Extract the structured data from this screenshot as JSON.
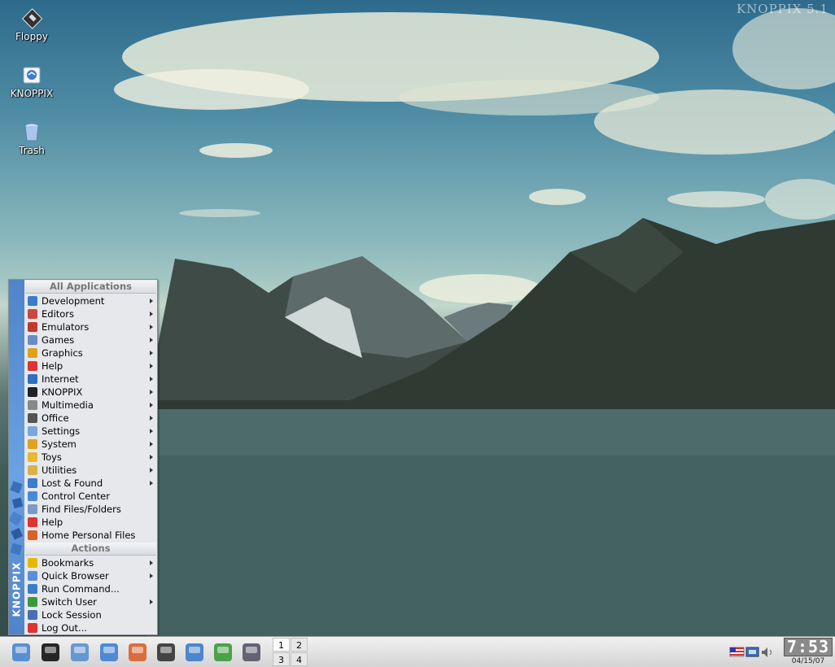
{
  "desktop": {
    "watermark": "KNOPPIX 5.1",
    "icons": [
      {
        "label": "Floppy",
        "icon": "floppy-icon"
      },
      {
        "label": "KNOPPIX",
        "icon": "knoppix-home-icon"
      },
      {
        "label": "Trash",
        "icon": "trash-icon"
      }
    ]
  },
  "kmenu": {
    "side_label": "KNOPPIX",
    "all_apps_header": "All Applications",
    "app_items": [
      {
        "label": "Development",
        "submenu": true,
        "icon": "development-icon",
        "color": "#3d7cc9"
      },
      {
        "label": "Editors",
        "submenu": true,
        "icon": "editors-icon",
        "color": "#c94a3d"
      },
      {
        "label": "Emulators",
        "submenu": true,
        "icon": "emulators-icon",
        "color": "#c0392b"
      },
      {
        "label": "Games",
        "submenu": true,
        "icon": "games-icon",
        "color": "#6a8cc7"
      },
      {
        "label": "Graphics",
        "submenu": true,
        "icon": "graphics-icon",
        "color": "#e0a020"
      },
      {
        "label": "Help",
        "submenu": true,
        "icon": "help-lifebuoy-icon",
        "color": "#d33"
      },
      {
        "label": "Internet",
        "submenu": true,
        "icon": "internet-globe-icon",
        "color": "#2e6fc0"
      },
      {
        "label": "KNOPPIX",
        "submenu": true,
        "icon": "knoppix-penguin-icon",
        "color": "#222"
      },
      {
        "label": "Multimedia",
        "submenu": true,
        "icon": "multimedia-icon",
        "color": "#888"
      },
      {
        "label": "Office",
        "submenu": true,
        "icon": "office-icon",
        "color": "#555"
      },
      {
        "label": "Settings",
        "submenu": true,
        "icon": "settings-icon",
        "color": "#7aa7d8"
      },
      {
        "label": "System",
        "submenu": true,
        "icon": "system-icon",
        "color": "#e0a020"
      },
      {
        "label": "Toys",
        "submenu": true,
        "icon": "toys-icon",
        "color": "#e8b830"
      },
      {
        "label": "Utilities",
        "submenu": true,
        "icon": "utilities-icon",
        "color": "#d9b34a"
      },
      {
        "label": "Lost & Found",
        "submenu": true,
        "icon": "lost-found-icon",
        "color": "#3d7cc9"
      },
      {
        "label": "Control Center",
        "submenu": false,
        "icon": "control-center-icon",
        "color": "#4a8ad4"
      },
      {
        "label": "Find Files/Folders",
        "submenu": false,
        "icon": "find-files-icon",
        "color": "#7a9bc4"
      },
      {
        "label": "Help",
        "submenu": false,
        "icon": "help-lifebuoy-icon",
        "color": "#d33"
      },
      {
        "label": "Home Personal Files",
        "submenu": false,
        "icon": "home-icon",
        "color": "#d9602a"
      }
    ],
    "actions_header": "Actions",
    "action_items": [
      {
        "label": "Bookmarks",
        "submenu": true,
        "icon": "bookmarks-star-icon",
        "color": "#e6b800"
      },
      {
        "label": "Quick Browser",
        "submenu": true,
        "icon": "quick-browser-icon",
        "color": "#5b8fd6"
      },
      {
        "label": "Run Command...",
        "submenu": false,
        "icon": "run-command-icon",
        "color": "#3d7cc9"
      },
      {
        "label": "Switch User",
        "submenu": true,
        "icon": "switch-user-icon",
        "color": "#3a9a3a"
      },
      {
        "label": "Lock Session",
        "submenu": false,
        "icon": "lock-session-icon",
        "color": "#4a6fb0"
      },
      {
        "label": "Log Out...",
        "submenu": false,
        "icon": "log-out-icon",
        "color": "#d33"
      }
    ]
  },
  "taskbar": {
    "launchers": [
      {
        "icon": "kmenu-icon",
        "color": "#4a86cf"
      },
      {
        "icon": "penguin-icon",
        "color": "#111"
      },
      {
        "icon": "konsole-terminal-icon",
        "color": "#5a8fd0"
      },
      {
        "icon": "file-manager-icon",
        "color": "#3f7fd0"
      },
      {
        "icon": "home-folder-icon",
        "color": "#d9602a"
      },
      {
        "icon": "terminal-icon",
        "color": "#333"
      },
      {
        "icon": "network-icon",
        "color": "#3d7cc9"
      },
      {
        "icon": "browser-icon",
        "color": "#3a9a3a"
      },
      {
        "icon": "office-app-icon",
        "color": "#556"
      }
    ],
    "pager": {
      "desktops": [
        "1",
        "2",
        "3",
        "4"
      ],
      "active": "1"
    },
    "tray": [
      "us-flag-icon",
      "keyboard-layout-icon",
      "volume-icon"
    ],
    "clock": {
      "time": "7:53",
      "date": "04/15/07"
    }
  }
}
